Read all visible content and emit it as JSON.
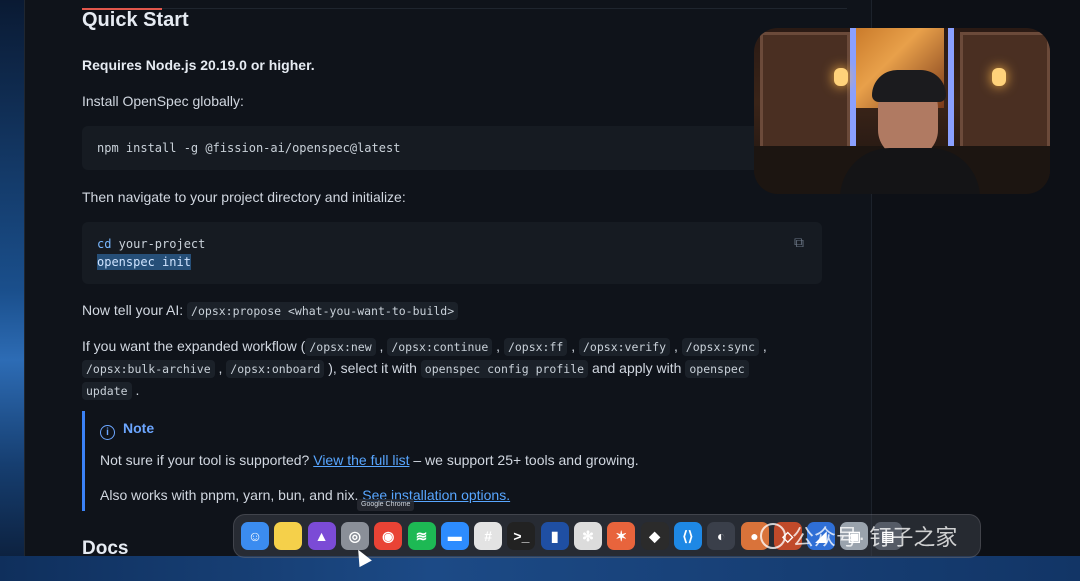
{
  "section_title": "Quick Start",
  "requirements": "Requires Node.js 20.19.0 or higher.",
  "install_intro": "Install OpenSpec globally:",
  "install_command": "npm install -g @fission-ai/openspec@latest",
  "navigate_intro": "Then navigate to your project directory and initialize:",
  "init_code": {
    "cd_keyword": "cd",
    "cd_arg": " your-project",
    "init_line": "openspec init"
  },
  "tell_ai": {
    "prefix": "Now tell your AI:",
    "command": "/opsx:propose <what-you-want-to-build>"
  },
  "expanded": {
    "prefix": "If you want the expanded workflow (",
    "commands": [
      "/opsx:new",
      "/opsx:continue",
      "/opsx:ff",
      "/opsx:verify",
      "/opsx:sync",
      "/opsx:bulk-archive",
      "/opsx:onboard"
    ],
    "middle": "), select it with",
    "profile_cmd": "openspec config profile",
    "and_apply": "and apply with",
    "update_cmd_a": "openspec",
    "update_cmd_b": "update",
    "suffix": "."
  },
  "note": {
    "icon": "info-icon",
    "title": "Note",
    "line1_prefix": "Not sure if your tool is supported?",
    "line1_link": "View the full list",
    "line1_suffix": "– we support 25+ tools and growing.",
    "line2_prefix": "Also works with pnpm, yarn, bun, and nix.",
    "line2_link": "See installation options."
  },
  "docs_title": "Docs",
  "dock": {
    "tooltip": "Google Chrome",
    "apps": [
      {
        "name": "finder",
        "glyph": "☺",
        "color": "#3b8cf0"
      },
      {
        "name": "notes",
        "glyph": "",
        "color": "#f5d04a"
      },
      {
        "name": "app-purple",
        "glyph": "▲",
        "color": "#7b4bd6"
      },
      {
        "name": "app-gray",
        "glyph": "◎",
        "color": "#8a8f98"
      },
      {
        "name": "chrome",
        "glyph": "◉",
        "color": "#e94335"
      },
      {
        "name": "spotify",
        "glyph": "≋",
        "color": "#1db954"
      },
      {
        "name": "zoom",
        "glyph": "▬",
        "color": "#2d8cff"
      },
      {
        "name": "slack",
        "glyph": "#",
        "color": "#e3e3e3"
      },
      {
        "name": "terminal",
        "glyph": ">_",
        "color": "#222"
      },
      {
        "name": "app-blue",
        "glyph": "▮",
        "color": "#1f4fa3"
      },
      {
        "name": "chatgpt",
        "glyph": "✻",
        "color": "#dcdcdc"
      },
      {
        "name": "app-orange",
        "glyph": "✶",
        "color": "#e8643c"
      },
      {
        "name": "app-cube",
        "glyph": "◆",
        "color": "#2b2b2b"
      },
      {
        "name": "vscode",
        "glyph": "⟨⟩",
        "color": "#1e88e5"
      },
      {
        "name": "app-dark",
        "glyph": "◐",
        "color": "#3a3f4a"
      },
      {
        "name": "app-warm",
        "glyph": "●",
        "color": "#d9733a"
      },
      {
        "name": "app-chat",
        "glyph": "◇",
        "color": "#c04a2a"
      },
      {
        "name": "app-blue2",
        "glyph": "◢",
        "color": "#2f6fd6"
      },
      {
        "name": "app-gray2",
        "glyph": "▣",
        "color": "#9aa3ad"
      },
      {
        "name": "app-gray3",
        "glyph": "▤",
        "color": "#555b66"
      }
    ]
  },
  "watermark": {
    "label": "公众号·",
    "name": "钉子之家"
  }
}
